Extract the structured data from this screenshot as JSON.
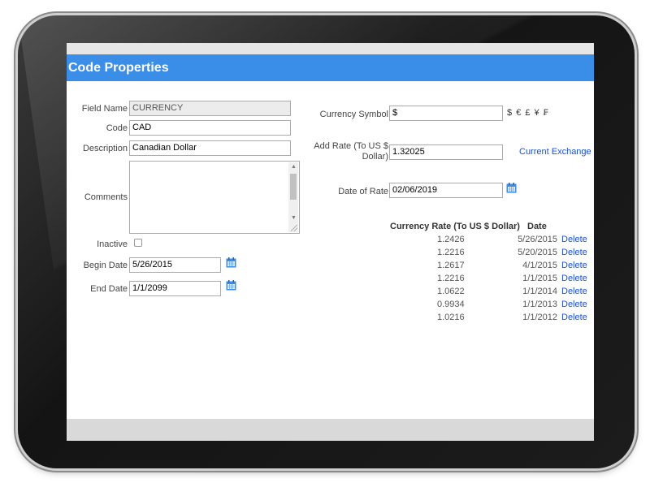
{
  "window": {
    "title": "Code Properties"
  },
  "left": {
    "field_name_label": "Field Name",
    "field_name_value": "CURRENCY",
    "code_label": "Code",
    "code_value": "CAD",
    "description_label": "Description",
    "description_value": "Canadian Dollar",
    "comments_label": "Comments",
    "comments_value": "",
    "inactive_label": "Inactive",
    "inactive_checked": false,
    "begin_date_label": "Begin Date",
    "begin_date_value": "5/26/2015",
    "end_date_label": "End Date",
    "end_date_value": "1/1/2099"
  },
  "right": {
    "currency_symbol_label": "Currency Symbol",
    "currency_symbol_value": "$",
    "symbols_hint": "$ € £ ¥ ₣",
    "add_rate_label_line1": "Add Rate (To US $",
    "add_rate_label_line2": "Dollar)",
    "add_rate_value": "1.32025",
    "current_exchange_link": "Current Exchange",
    "date_of_rate_label": "Date of Rate",
    "date_of_rate_value": "02/06/2019"
  },
  "rates": {
    "header_rate": "Currency Rate (To US $ Dollar)",
    "header_date": "Date",
    "rows": [
      {
        "rate": "1.2426",
        "date": "5/26/2015",
        "action": "Delete"
      },
      {
        "rate": "1.2216",
        "date": "5/20/2015",
        "action": "Delete"
      },
      {
        "rate": "1.2617",
        "date": "4/1/2015",
        "action": "Delete"
      },
      {
        "rate": "1.2216",
        "date": "1/1/2015",
        "action": "Delete"
      },
      {
        "rate": "1.0622",
        "date": "1/1/2014",
        "action": "Delete"
      },
      {
        "rate": "0.9934",
        "date": "1/1/2013",
        "action": "Delete"
      },
      {
        "rate": "1.0216",
        "date": "1/1/2012",
        "action": "Delete"
      }
    ]
  },
  "colors": {
    "titlebar": "#3a8ee8",
    "link": "#1a4fd6"
  },
  "icons": {
    "calendar": "calendar-icon"
  }
}
